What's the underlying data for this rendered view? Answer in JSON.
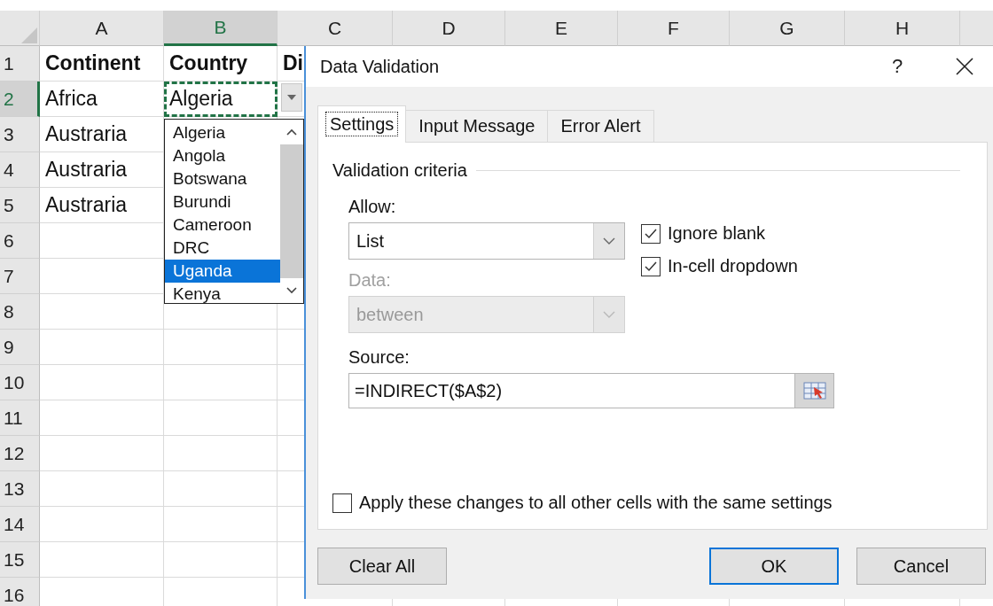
{
  "sheet": {
    "columns": [
      {
        "label": "A",
        "selected": false
      },
      {
        "label": "B",
        "selected": true
      },
      {
        "label": "C",
        "selected": false
      },
      {
        "label": "D",
        "selected": false
      },
      {
        "label": "E",
        "selected": false
      },
      {
        "label": "F",
        "selected": false
      },
      {
        "label": "G",
        "selected": false
      },
      {
        "label": "H",
        "selected": false
      }
    ],
    "rows": [
      {
        "number": "1",
        "selected": false,
        "cells": [
          "Continent",
          "Country",
          "Di"
        ]
      },
      {
        "number": "2",
        "selected": true,
        "cells": [
          "Africa",
          "Algeria"
        ]
      },
      {
        "number": "3",
        "selected": false,
        "cells": [
          "Austraria"
        ]
      },
      {
        "number": "4",
        "selected": false,
        "cells": [
          "Austraria"
        ]
      },
      {
        "number": "5",
        "selected": false,
        "cells": [
          "Austraria"
        ]
      },
      {
        "number": "6",
        "selected": false,
        "cells": []
      },
      {
        "number": "7",
        "selected": false,
        "cells": []
      },
      {
        "number": "8",
        "selected": false,
        "cells": []
      },
      {
        "number": "9",
        "selected": false,
        "cells": []
      },
      {
        "number": "10",
        "selected": false,
        "cells": []
      },
      {
        "number": "11",
        "selected": false,
        "cells": []
      },
      {
        "number": "12",
        "selected": false,
        "cells": []
      },
      {
        "number": "13",
        "selected": false,
        "cells": []
      },
      {
        "number": "14",
        "selected": false,
        "cells": []
      },
      {
        "number": "15",
        "selected": false,
        "cells": []
      },
      {
        "number": "16",
        "selected": false,
        "cells": []
      }
    ]
  },
  "cell_dropdown": {
    "items": [
      {
        "label": "Algeria",
        "selected": false
      },
      {
        "label": "Angola",
        "selected": false
      },
      {
        "label": "Botswana",
        "selected": false
      },
      {
        "label": "Burundi",
        "selected": false
      },
      {
        "label": "Cameroon",
        "selected": false
      },
      {
        "label": "DRC",
        "selected": false
      },
      {
        "label": "Uganda",
        "selected": true
      },
      {
        "label": "Kenya",
        "selected": false
      }
    ]
  },
  "dialog": {
    "title": "Data Validation",
    "help": "?",
    "tabs": [
      {
        "label": "Settings",
        "selected": true
      },
      {
        "label": "Input Message",
        "selected": false
      },
      {
        "label": "Error Alert",
        "selected": false
      }
    ],
    "section_title": "Validation criteria",
    "allow": {
      "label": "Allow:",
      "value": "List",
      "disabled": false
    },
    "data": {
      "label": "Data:",
      "value": "between",
      "disabled": true
    },
    "checkboxes": [
      {
        "label": "Ignore blank",
        "checked": true
      },
      {
        "label": "In-cell dropdown",
        "checked": true
      }
    ],
    "source": {
      "label": "Source:",
      "value": "=INDIRECT($A$2)"
    },
    "apply_all": {
      "label": "Apply these changes to all other cells with the same settings",
      "checked": false
    },
    "buttons": [
      {
        "label": "Clear All",
        "kind": "left",
        "default": false
      },
      {
        "label": "OK",
        "kind": "right",
        "default": true
      },
      {
        "label": "Cancel",
        "kind": "right",
        "default": false
      }
    ]
  }
}
